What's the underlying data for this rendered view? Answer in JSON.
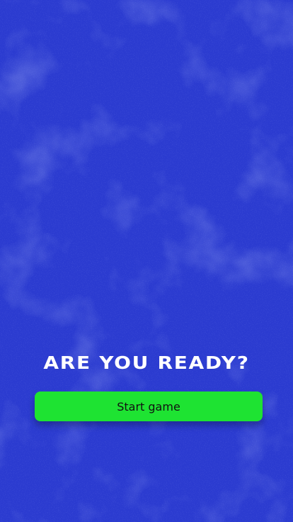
{
  "screen": {
    "background_color": "#2b3bd0",
    "headline": "ARE YOU READY?",
    "start_button_label": "Start game",
    "button_color": "#1ee332",
    "text_color": "#ffffff"
  }
}
